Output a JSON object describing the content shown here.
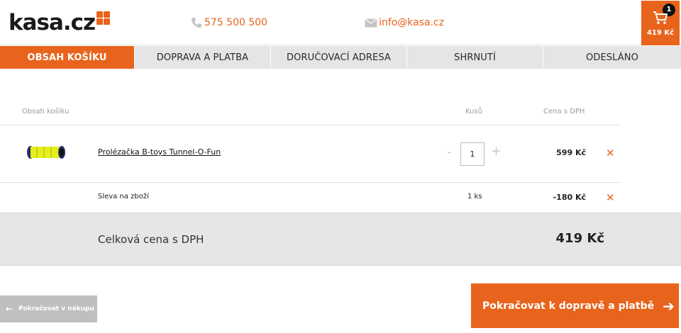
{
  "header": {
    "logo_text": "kasa.cz",
    "phone": "575 500 500",
    "email": "info@kasa.cz",
    "cart": {
      "count": "1",
      "total": "419 Kč"
    }
  },
  "steps": [
    {
      "label": "OBSAH KOŠÍKU",
      "active": true
    },
    {
      "label": "DOPRAVA A PLATBA",
      "active": false
    },
    {
      "label": "DORUČOVACÍ ADRESA",
      "active": false
    },
    {
      "label": "SHRNUTÍ",
      "active": false
    },
    {
      "label": "ODESLÁNO",
      "active": false
    }
  ],
  "table": {
    "headers": {
      "name": "Obsah košíku",
      "qty": "Kusů",
      "price": "Cena s DPH"
    },
    "items": [
      {
        "name": "Prolézačka B-toys Tunnel-O-Fun",
        "qty": "1",
        "qty_minus": "-",
        "qty_plus": "+",
        "price": "599 Kč",
        "remove": "✕",
        "image_icon": "tunnel-toy-icon"
      }
    ],
    "discount": {
      "label": "Sleva na zboží",
      "qty": "1 ks",
      "price": "-180 Kč",
      "remove": "✕"
    }
  },
  "total": {
    "label": "Celková cena s DPH",
    "value": "419 Kč"
  },
  "actions": {
    "back_label": "Pokračovat v nákupu",
    "back_arrow": "←",
    "next_label": "Pokračovat k dopravě a platbě",
    "next_arrow": "➔"
  },
  "colors": {
    "accent": "#e8641c",
    "step_bg": "#e5e5e5",
    "total_bg": "#e6e6e6",
    "back_btn": "#bfbfbf"
  }
}
